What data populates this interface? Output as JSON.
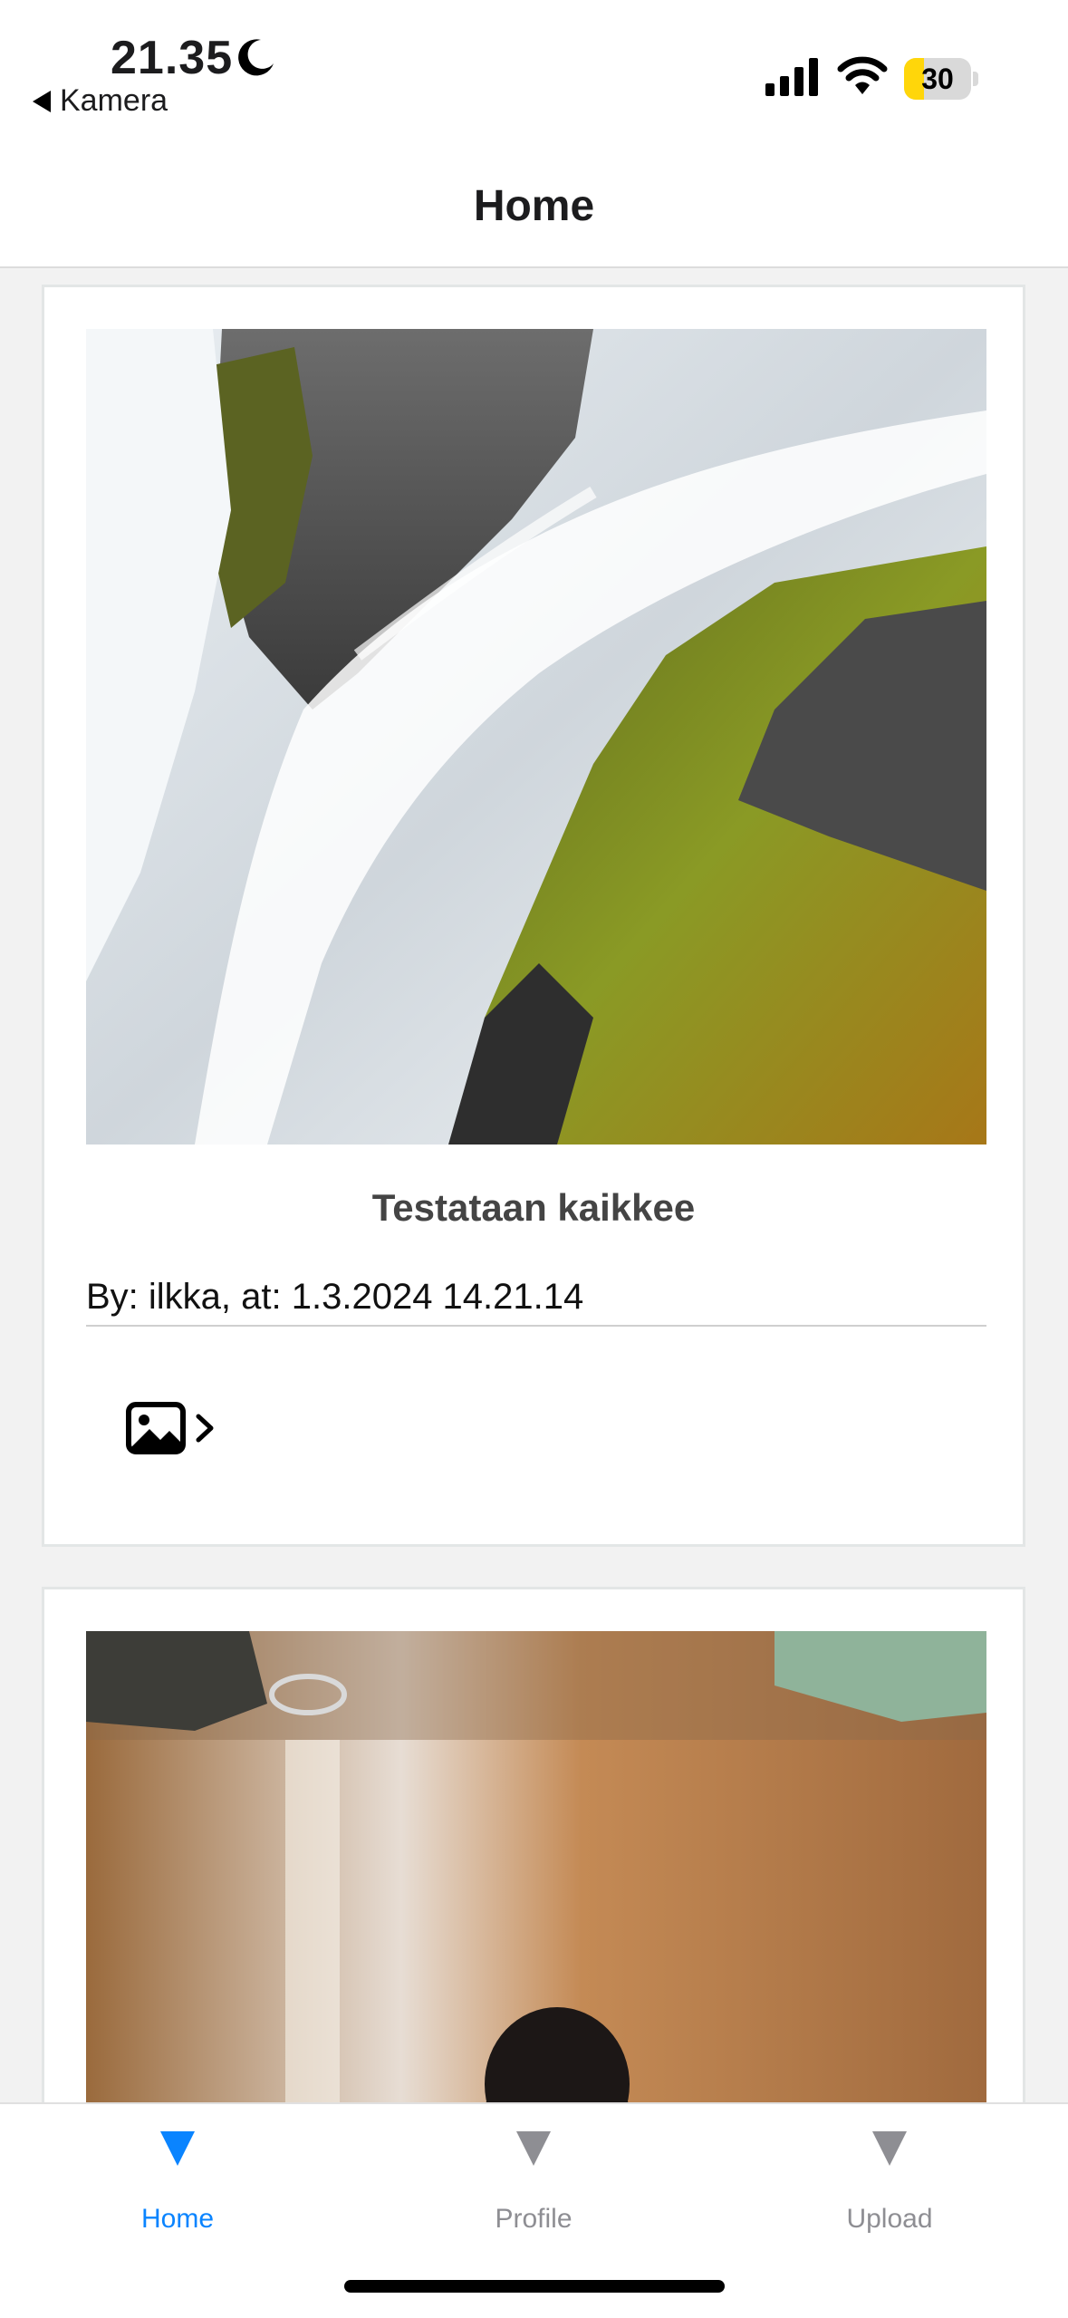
{
  "status_bar": {
    "time": "21.35",
    "back_app": "Kamera",
    "battery": "30",
    "battery_level": 0.3,
    "icons": [
      "moon-icon",
      "cellular-signal-icon",
      "wifi-icon",
      "battery-icon"
    ]
  },
  "header": {
    "title": "Home"
  },
  "feed": {
    "posts": [
      {
        "title": "Testataan kaikkee",
        "meta": "By: ilkka, at: 1.3.2024 14.21.14",
        "media": "waterfall-photo",
        "action_icons": [
          "image-icon",
          "chevron-right-icon"
        ]
      },
      {
        "media": "dog-photo"
      }
    ]
  },
  "tabbar": {
    "tabs": [
      {
        "label": "Home",
        "active": true
      },
      {
        "label": "Profile",
        "active": false
      },
      {
        "label": "Upload",
        "active": false
      }
    ],
    "active_color": "#0a84ff",
    "inactive_color": "#8e8e93"
  }
}
